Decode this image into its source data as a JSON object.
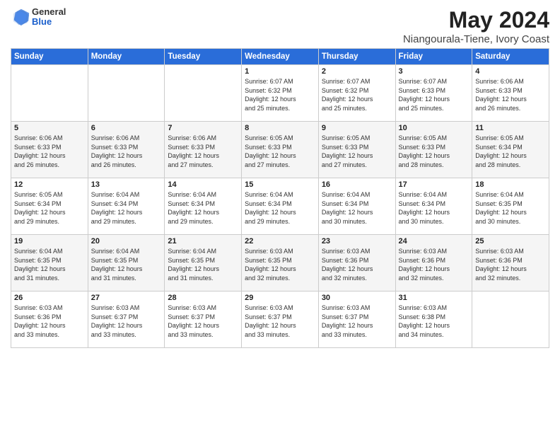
{
  "header": {
    "logo_general": "General",
    "logo_blue": "Blue",
    "title": "May 2024",
    "subtitle": "Niangourala-Tiene, Ivory Coast"
  },
  "days_of_week": [
    "Sunday",
    "Monday",
    "Tuesday",
    "Wednesday",
    "Thursday",
    "Friday",
    "Saturday"
  ],
  "weeks": [
    [
      {
        "day": "",
        "info": ""
      },
      {
        "day": "",
        "info": ""
      },
      {
        "day": "",
        "info": ""
      },
      {
        "day": "1",
        "info": "Sunrise: 6:07 AM\nSunset: 6:32 PM\nDaylight: 12 hours\nand 25 minutes."
      },
      {
        "day": "2",
        "info": "Sunrise: 6:07 AM\nSunset: 6:32 PM\nDaylight: 12 hours\nand 25 minutes."
      },
      {
        "day": "3",
        "info": "Sunrise: 6:07 AM\nSunset: 6:33 PM\nDaylight: 12 hours\nand 25 minutes."
      },
      {
        "day": "4",
        "info": "Sunrise: 6:06 AM\nSunset: 6:33 PM\nDaylight: 12 hours\nand 26 minutes."
      }
    ],
    [
      {
        "day": "5",
        "info": "Sunrise: 6:06 AM\nSunset: 6:33 PM\nDaylight: 12 hours\nand 26 minutes."
      },
      {
        "day": "6",
        "info": "Sunrise: 6:06 AM\nSunset: 6:33 PM\nDaylight: 12 hours\nand 26 minutes."
      },
      {
        "day": "7",
        "info": "Sunrise: 6:06 AM\nSunset: 6:33 PM\nDaylight: 12 hours\nand 27 minutes."
      },
      {
        "day": "8",
        "info": "Sunrise: 6:05 AM\nSunset: 6:33 PM\nDaylight: 12 hours\nand 27 minutes."
      },
      {
        "day": "9",
        "info": "Sunrise: 6:05 AM\nSunset: 6:33 PM\nDaylight: 12 hours\nand 27 minutes."
      },
      {
        "day": "10",
        "info": "Sunrise: 6:05 AM\nSunset: 6:33 PM\nDaylight: 12 hours\nand 28 minutes."
      },
      {
        "day": "11",
        "info": "Sunrise: 6:05 AM\nSunset: 6:34 PM\nDaylight: 12 hours\nand 28 minutes."
      }
    ],
    [
      {
        "day": "12",
        "info": "Sunrise: 6:05 AM\nSunset: 6:34 PM\nDaylight: 12 hours\nand 29 minutes."
      },
      {
        "day": "13",
        "info": "Sunrise: 6:04 AM\nSunset: 6:34 PM\nDaylight: 12 hours\nand 29 minutes."
      },
      {
        "day": "14",
        "info": "Sunrise: 6:04 AM\nSunset: 6:34 PM\nDaylight: 12 hours\nand 29 minutes."
      },
      {
        "day": "15",
        "info": "Sunrise: 6:04 AM\nSunset: 6:34 PM\nDaylight: 12 hours\nand 29 minutes."
      },
      {
        "day": "16",
        "info": "Sunrise: 6:04 AM\nSunset: 6:34 PM\nDaylight: 12 hours\nand 30 minutes."
      },
      {
        "day": "17",
        "info": "Sunrise: 6:04 AM\nSunset: 6:34 PM\nDaylight: 12 hours\nand 30 minutes."
      },
      {
        "day": "18",
        "info": "Sunrise: 6:04 AM\nSunset: 6:35 PM\nDaylight: 12 hours\nand 30 minutes."
      }
    ],
    [
      {
        "day": "19",
        "info": "Sunrise: 6:04 AM\nSunset: 6:35 PM\nDaylight: 12 hours\nand 31 minutes."
      },
      {
        "day": "20",
        "info": "Sunrise: 6:04 AM\nSunset: 6:35 PM\nDaylight: 12 hours\nand 31 minutes."
      },
      {
        "day": "21",
        "info": "Sunrise: 6:04 AM\nSunset: 6:35 PM\nDaylight: 12 hours\nand 31 minutes."
      },
      {
        "day": "22",
        "info": "Sunrise: 6:03 AM\nSunset: 6:35 PM\nDaylight: 12 hours\nand 32 minutes."
      },
      {
        "day": "23",
        "info": "Sunrise: 6:03 AM\nSunset: 6:36 PM\nDaylight: 12 hours\nand 32 minutes."
      },
      {
        "day": "24",
        "info": "Sunrise: 6:03 AM\nSunset: 6:36 PM\nDaylight: 12 hours\nand 32 minutes."
      },
      {
        "day": "25",
        "info": "Sunrise: 6:03 AM\nSunset: 6:36 PM\nDaylight: 12 hours\nand 32 minutes."
      }
    ],
    [
      {
        "day": "26",
        "info": "Sunrise: 6:03 AM\nSunset: 6:36 PM\nDaylight: 12 hours\nand 33 minutes."
      },
      {
        "day": "27",
        "info": "Sunrise: 6:03 AM\nSunset: 6:37 PM\nDaylight: 12 hours\nand 33 minutes."
      },
      {
        "day": "28",
        "info": "Sunrise: 6:03 AM\nSunset: 6:37 PM\nDaylight: 12 hours\nand 33 minutes."
      },
      {
        "day": "29",
        "info": "Sunrise: 6:03 AM\nSunset: 6:37 PM\nDaylight: 12 hours\nand 33 minutes."
      },
      {
        "day": "30",
        "info": "Sunrise: 6:03 AM\nSunset: 6:37 PM\nDaylight: 12 hours\nand 33 minutes."
      },
      {
        "day": "31",
        "info": "Sunrise: 6:03 AM\nSunset: 6:38 PM\nDaylight: 12 hours\nand 34 minutes."
      },
      {
        "day": "",
        "info": ""
      }
    ]
  ]
}
